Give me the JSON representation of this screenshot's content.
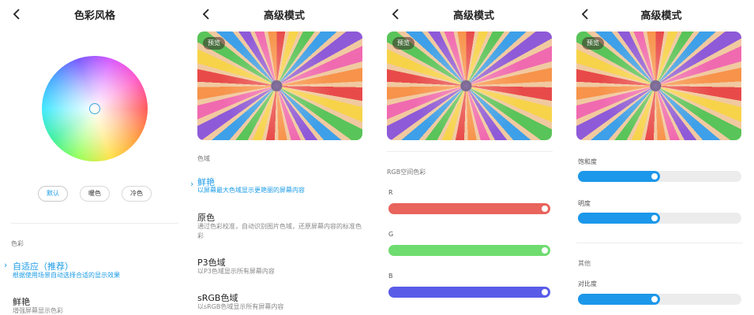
{
  "panel1": {
    "title": "色彩风格",
    "chips": [
      "默认",
      "暖色",
      "冷色"
    ],
    "section_label": "色彩",
    "options": [
      {
        "title": "自适应（推荐）",
        "desc": "根据使用场景自动选择合适的显示效果",
        "active": true
      },
      {
        "title": "鲜艳",
        "desc": "增强屏幕显示色彩",
        "active": false
      }
    ]
  },
  "panel2": {
    "title": "高级模式",
    "preview_badge": "预览",
    "section_label": "色域",
    "options": [
      {
        "title": "鲜艳",
        "desc": "以屏幕最大色域显示更艳丽的屏幕内容",
        "active": true
      },
      {
        "title": "原色",
        "desc": "通过色彩校准，自动识别图片色域，还原屏幕内容的标准色彩",
        "active": false
      },
      {
        "title": "P3色域",
        "desc": "以P3色域显示所有屏幕内容",
        "active": false
      },
      {
        "title": "sRGB色域",
        "desc": "以sRGB色域显示所有屏幕内容",
        "active": false
      }
    ]
  },
  "panel3": {
    "title": "高级模式",
    "preview_badge": "预览",
    "section_label": "RGB空间色彩",
    "channels": [
      {
        "label": "R",
        "color": "#e8645c",
        "value": 1.0
      },
      {
        "label": "G",
        "color": "#6fdc6f",
        "value": 1.0
      },
      {
        "label": "B",
        "color": "#5a5ce8",
        "value": 1.0
      }
    ]
  },
  "panel4": {
    "title": "高级模式",
    "preview_badge": "预览",
    "sliders_top": [
      {
        "label": "饱和度",
        "value": 0.5
      },
      {
        "label": "明度",
        "value": 0.5
      }
    ],
    "section_label": "其他",
    "sliders_bottom": [
      {
        "label": "对比度",
        "value": 0.5
      }
    ]
  },
  "colors": {
    "accent": "#1a9be6",
    "slider_fill": "#1c97ea",
    "track": "#ececec"
  },
  "icons": [
    "back-arrow-icon",
    "chevron-right-icon"
  ]
}
